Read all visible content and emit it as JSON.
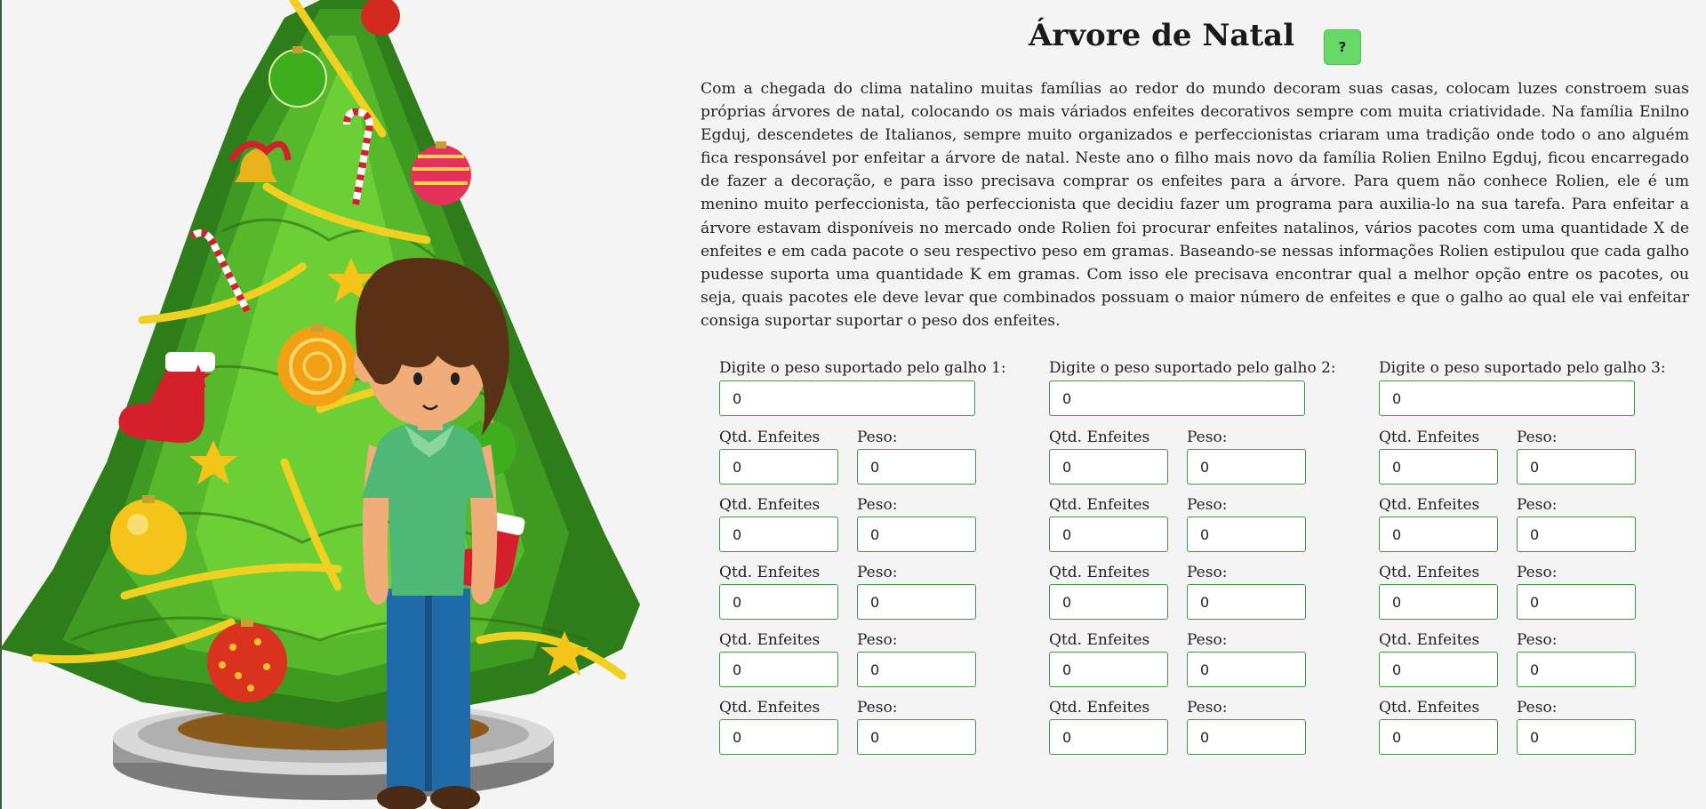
{
  "page": {
    "title": "Árvore de Natal",
    "help_label": "?",
    "description": "Com a chegada do clima natalino muitas famílias ao redor do mundo decoram suas casas, colocam luzes constroem suas próprias árvores de natal, colocando os mais váriados enfeites decorativos sempre com muita criatividade. Na família Enilno Egduj, descendetes de Italianos, sempre muito organizados e perfeccionistas criaram uma tradição onde todo o ano alguém fica responsável por enfeitar a árvore de natal. Neste ano o filho mais novo da família Rolien Enilno Egduj, ficou encarregado de fazer a decoração, e para isso precisava comprar os enfeites para a árvore. Para quem não conhece Rolien, ele é um menino muito perfeccionista, tão perfeccionista que decidiu fazer um programa para auxilia-lo na sua tarefa. Para enfeitar a árvore estavam disponíveis no mercado onde Rolien foi procurar enfeites natalinos, vários pacotes com uma quantidade X de enfeites e em cada pacote o seu respectivo peso em gramas. Baseando-se nessas informações Rolien estipulou que cada galho pudesse suporta uma quantidade K em gramas. Com isso ele precisava encontrar qual a melhor opção entre os pacotes, ou seja, quais pacotes ele deve levar que combinados possuam o maior número de enfeites e que o galho ao qual ele vai enfeitar consiga suportar suportar o peso dos enfeites."
  },
  "colors": {
    "accent_green": "#66d966",
    "input_border": "#3f9a3f",
    "background": "#f4f4f4"
  },
  "branches": [
    {
      "weight_label": "Digite o peso suportado pelo galho 1:",
      "weight_value": "0",
      "packages": [
        {
          "qty_label": "Qtd. Enfeites",
          "qty_value": "0",
          "weight_label": "Peso:",
          "weight_value": "0"
        },
        {
          "qty_label": "Qtd. Enfeites",
          "qty_value": "0",
          "weight_label": "Peso:",
          "weight_value": "0"
        },
        {
          "qty_label": "Qtd. Enfeites",
          "qty_value": "0",
          "weight_label": "Peso:",
          "weight_value": "0"
        },
        {
          "qty_label": "Qtd. Enfeites",
          "qty_value": "0",
          "weight_label": "Peso:",
          "weight_value": "0"
        },
        {
          "qty_label": "Qtd. Enfeites",
          "qty_value": "0",
          "weight_label": "Peso:",
          "weight_value": "0"
        }
      ]
    },
    {
      "weight_label": "Digite o peso suportado pelo galho 2:",
      "weight_value": "0",
      "packages": [
        {
          "qty_label": "Qtd. Enfeites",
          "qty_value": "0",
          "weight_label": "Peso:",
          "weight_value": "0"
        },
        {
          "qty_label": "Qtd. Enfeites",
          "qty_value": "0",
          "weight_label": "Peso:",
          "weight_value": "0"
        },
        {
          "qty_label": "Qtd. Enfeites",
          "qty_value": "0",
          "weight_label": "Peso:",
          "weight_value": "0"
        },
        {
          "qty_label": "Qtd. Enfeites",
          "qty_value": "0",
          "weight_label": "Peso:",
          "weight_value": "0"
        },
        {
          "qty_label": "Qtd. Enfeites",
          "qty_value": "0",
          "weight_label": "Peso:",
          "weight_value": "0"
        }
      ]
    },
    {
      "weight_label": "Digite o peso suportado pelo galho 3:",
      "weight_value": "0",
      "packages": [
        {
          "qty_label": "Qtd. Enfeites",
          "qty_value": "0",
          "weight_label": "Peso:",
          "weight_value": "0"
        },
        {
          "qty_label": "Qtd. Enfeites",
          "qty_value": "0",
          "weight_label": "Peso:",
          "weight_value": "0"
        },
        {
          "qty_label": "Qtd. Enfeites",
          "qty_value": "0",
          "weight_label": "Peso:",
          "weight_value": "0"
        },
        {
          "qty_label": "Qtd. Enfeites",
          "qty_value": "0",
          "weight_label": "Peso:",
          "weight_value": "0"
        },
        {
          "qty_label": "Qtd. Enfeites",
          "qty_value": "0",
          "weight_label": "Peso:",
          "weight_value": "0"
        }
      ]
    }
  ]
}
